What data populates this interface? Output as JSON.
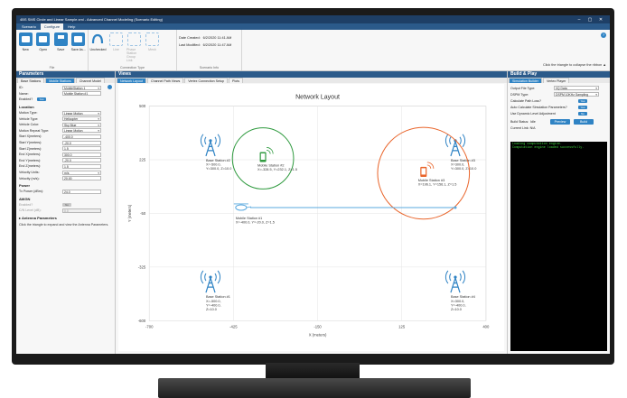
{
  "window": {
    "title": "4BS SMS Circle and Linear Sample.xml - Advanced Channel Modeling (Scenario Editing)",
    "minimize": "–",
    "maximize": "▢",
    "close": "✕"
  },
  "menu": [
    "Scenario",
    "Configure",
    "Help"
  ],
  "ribbon": {
    "file_buttons": [
      "New",
      "Open",
      "Save",
      "Save As..."
    ],
    "file_group": "File",
    "connection_buttons": [
      "Unchecked",
      "Line",
      "Phase Station Group Link",
      "Mesh"
    ],
    "connection_group": "Connection Type",
    "info": [
      {
        "label": "Date Created:",
        "value": "6/2/2020 11:41 AM"
      },
      {
        "label": "Last Modified:",
        "value": "6/2/2020 11:47 AM"
      }
    ],
    "info_group": "Scenario Info",
    "collapse_hint": "Click the triangle to collapse the ribbon ▲",
    "help": "?"
  },
  "parameters": {
    "title": "Parameters",
    "tabs": [
      "Base Stations",
      "Mobile Stations",
      "Channel Model"
    ],
    "id": {
      "label": "ID:",
      "value": "MobileStation 1"
    },
    "name": {
      "label": "Name:",
      "value": "Mobile Station #1"
    },
    "enabled": {
      "label": "Enabled?",
      "value": "Yes"
    },
    "location_title": "Location",
    "rows": [
      {
        "label": "Motion Type:",
        "value": "Linear Motion"
      },
      {
        "label": "Vehicle Type:",
        "value": "Helicopter"
      },
      {
        "label": "Vehicle Color:",
        "value": "Sky Blue"
      },
      {
        "label": "Motion Repeat Type:",
        "value": "Linear Motion"
      },
      {
        "label": "Start X(meters):",
        "value": "-400.0"
      },
      {
        "label": "Start Y(meters):",
        "value": "-20.0"
      },
      {
        "label": "Start Z(meters):",
        "value": "1.5"
      },
      {
        "label": "End X(meters):",
        "value": "300.0"
      },
      {
        "label": "End Y(meters):",
        "value": "-20.0"
      },
      {
        "label": "End Z(meters):",
        "value": "1.5"
      },
      {
        "label": "Velocity Units:",
        "value": "m/s"
      },
      {
        "label": "Velocity (m/s):",
        "value": "20.00"
      }
    ],
    "power_title": "Power",
    "power_rows": [
      {
        "label": "Tx Power (dBm):",
        "value": "24.0"
      }
    ],
    "awgn_title": "AWGN",
    "awgn_rows": [
      {
        "label": "Enabled?",
        "value": "No"
      },
      {
        "label": "C/N Level (dB):",
        "value": "0.0"
      }
    ],
    "antenna_title": "▸ Antenna Parameters",
    "antenna_hint": "Click the triangle to expand and view the Antenna Parameters."
  },
  "views": {
    "title": "Views",
    "tabs": [
      "Network Layout",
      "Channel Path Views",
      "Vertex Connection Setup",
      "Plots"
    ]
  },
  "chart_data": {
    "type": "scatter",
    "title": "Network Layout",
    "xlabel": "X (meters)",
    "ylabel": "Y (meters)",
    "xlim": [
      -700,
      400
    ],
    "ylim": [
      -600,
      500
    ],
    "xticks": [
      -700,
      -425,
      -150,
      125,
      400
    ],
    "yticks": [
      500,
      225,
      -50,
      -325,
      -600
    ],
    "grid": true,
    "series": [
      {
        "type": "base_station",
        "name": "Base Station #2",
        "x": -500.0,
        "y": 300.0,
        "z": 10.0,
        "label": [
          "Base Station #2",
          "X=-500.0,",
          "Y=300.0, Z=10.0"
        ]
      },
      {
        "type": "base_station",
        "name": "Base Station #3",
        "x": 300.0,
        "y": 300.0,
        "z": 10.0,
        "label": [
          "Base Station #3",
          "X=300.0,",
          "Y=300.0, Z=10.0"
        ]
      },
      {
        "type": "base_station",
        "name": "Base Station #1",
        "x": -500.0,
        "y": -400.0,
        "z": 10.0,
        "label": [
          "Base Station #1",
          "X=-500.0,",
          "Y=-400.0,",
          "Z=10.0"
        ]
      },
      {
        "type": "base_station",
        "name": "Base Station #4",
        "x": 300.0,
        "y": -400.0,
        "z": 10.0,
        "label": [
          "Base Station #4",
          "X=300.0,",
          "Y=-400.0,",
          "Z=10.0"
        ]
      },
      {
        "type": "mobile_station",
        "name": "Mobile Station #2",
        "x": -328.5,
        "y": 232.1,
        "z": 1.5,
        "color": "#2e9a3e",
        "radius": 100,
        "label": [
          "Mobile Station #2",
          "X=-328.5, Y=232.1, Z=1.5"
        ]
      },
      {
        "type": "mobile_station",
        "name": "Mobile Station #3",
        "x": 196.1,
        "y": 156.1,
        "z": 1.5,
        "color": "#e9652b",
        "radius": 150,
        "label": [
          "Mobile Station #3",
          "X=196.1, Y=156.1, Z=1.5"
        ]
      },
      {
        "type": "mobile_station",
        "name": "Mobile Station #1",
        "x": -400.0,
        "y": -20.0,
        "z": 1.5,
        "color": "#5aa9df",
        "path_end": [
          300.0,
          -20.0
        ],
        "label": [
          "Mobile Station #1",
          "X=-400.0, Y=-20.0, Z=1.5"
        ]
      }
    ]
  },
  "build": {
    "title": "Build & Play",
    "tabs": [
      "Simulation Builder",
      "Vertex Player"
    ],
    "rows": [
      {
        "label": "Output File Type:",
        "value": "I/Q Data"
      },
      {
        "label": "DSPM Type:",
        "value": "DSPM 10KHz Sampling"
      }
    ],
    "checks": [
      {
        "label": "Calculate Path Loss?",
        "value": "Yes"
      },
      {
        "label": "Auto Calculate Simulation Parameters?",
        "value": "Yes"
      },
      {
        "label": "Use Dynamic Level Adjustment",
        "value": "No"
      }
    ],
    "status_label": "Build Status:",
    "status_value": "Idle",
    "preview": "Preview",
    "build_btn": "Build",
    "current_link": "Current Link: N/A",
    "console": [
      "Loading computation engine.",
      "Computation engine loaded successfully."
    ]
  },
  "colors": {
    "accent": "#2f83c4",
    "header": "#2b5a8a",
    "title": "#1e3f66",
    "console_text": "#3fd13f"
  }
}
